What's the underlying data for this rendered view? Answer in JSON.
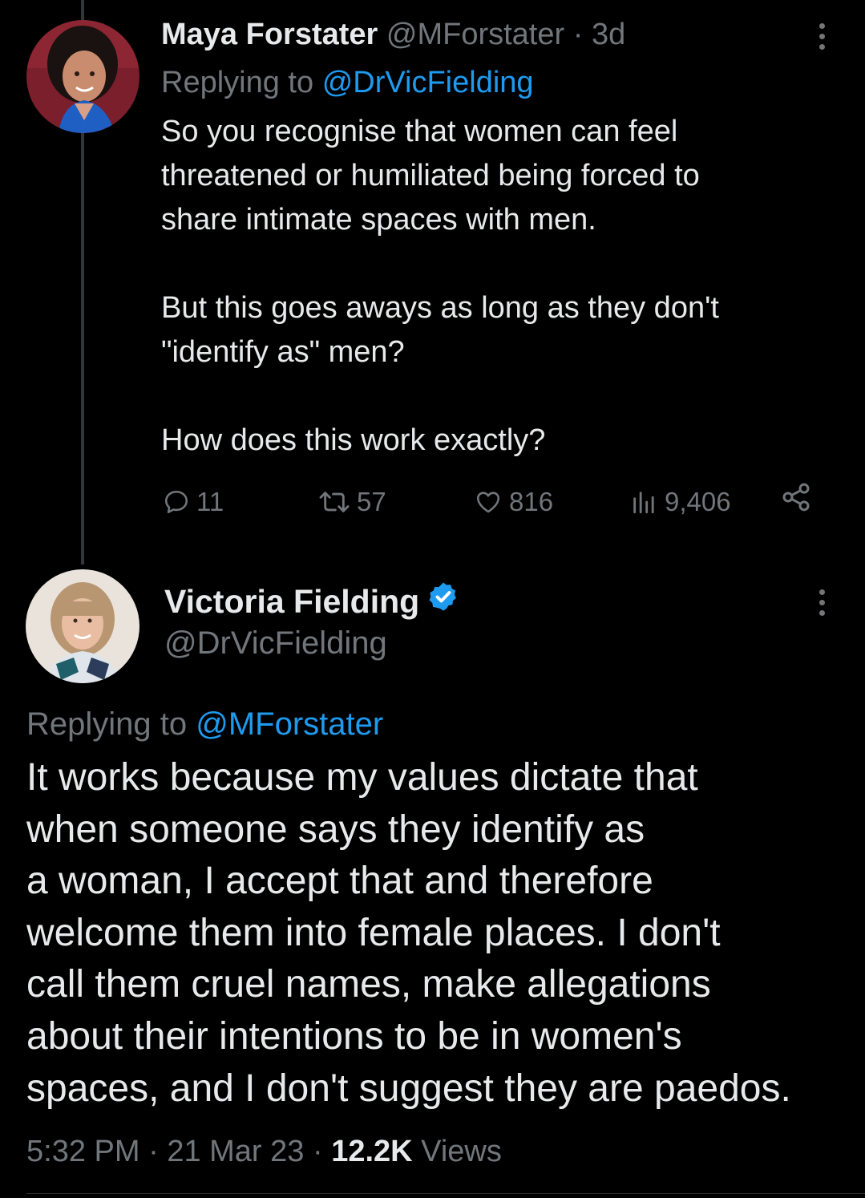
{
  "tweet1": {
    "display_name": "Maya Forstater",
    "handle": "@MForstater",
    "time": "3d",
    "replying_prefix": "Replying to",
    "replying_to": "@DrVicFielding",
    "body": "So you recognise that women can feel\nthreatened or humiliated being forced to\nshare intimate spaces with men.\n\nBut this goes aways as long as they don't\n\"identify as\" men?\n\nHow does this work exactly?",
    "replies": "11",
    "retweets": "57",
    "likes": "816",
    "views": "9,406",
    "icons": [
      "reply-icon",
      "retweet-icon",
      "like-icon",
      "views-icon",
      "share-icon",
      "more-icon"
    ]
  },
  "tweet2": {
    "display_name": "Victoria Fielding",
    "handle": "@DrVicFielding",
    "replying_prefix": "Replying to",
    "replying_to": "@MForstater",
    "body": "It works because my values dictate that\nwhen someone says they identify as\na woman, I accept that and therefore\nwelcome them into female places. I don't\ncall them cruel names, make allegations\nabout their intentions to be in women's\nspaces, and I don't suggest they are paedos.",
    "time": "5:32 PM",
    "date": "21 Mar 23",
    "views_count": "12.2K",
    "views_label": "Views",
    "icons": [
      "verified-badge-icon",
      "more-icon"
    ]
  },
  "colors": {
    "background": "#000000",
    "text": "#e7e9ea",
    "muted": "#71767b",
    "link": "#1d9bf0"
  }
}
